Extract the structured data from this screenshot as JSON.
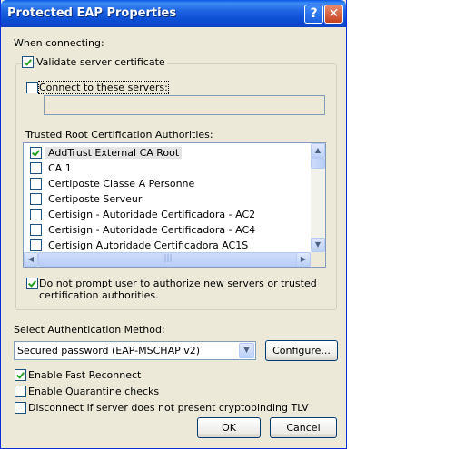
{
  "window": {
    "title": "Protected EAP Properties"
  },
  "titlebar": {
    "help_glyph": "?",
    "close_glyph": "✕"
  },
  "labels": {
    "when_connecting": "When connecting:",
    "validate_cert": "Validate server certificate",
    "connect_servers": "Connect to these servers:",
    "trusted_root": "Trusted Root Certification Authorities:",
    "no_prompt_line1": "Do not prompt user to authorize new servers or trusted",
    "no_prompt_line2": "certification authorities.",
    "select_auth": "Select Authentication Method:",
    "fast_reconnect": "Enable Fast Reconnect",
    "quarantine": "Enable Quarantine checks",
    "disconnect_tlv": "Disconnect if server does not present cryptobinding TLV"
  },
  "checkboxes": {
    "validate_cert": true,
    "connect_servers": false,
    "no_prompt": true,
    "fast_reconnect": true,
    "quarantine": false,
    "disconnect_tlv": false
  },
  "servers_input": {
    "value": ""
  },
  "ca_list": [
    {
      "label": "AddTrust External CA Root",
      "checked": true,
      "selected": true
    },
    {
      "label": "CA 1",
      "checked": false
    },
    {
      "label": "Certiposte Classe A Personne",
      "checked": false
    },
    {
      "label": "Certiposte Serveur",
      "checked": false
    },
    {
      "label": "Certisign - Autoridade Certificadora - AC2",
      "checked": false
    },
    {
      "label": "Certisign - Autoridade Certificadora - AC4",
      "checked": false
    },
    {
      "label": "Certisign Autoridade Certificadora AC1S",
      "checked": false
    }
  ],
  "auth_method": {
    "selected": "Secured password (EAP-MSCHAP v2)"
  },
  "buttons": {
    "configure": "Configure...",
    "ok": "OK",
    "cancel": "Cancel"
  }
}
